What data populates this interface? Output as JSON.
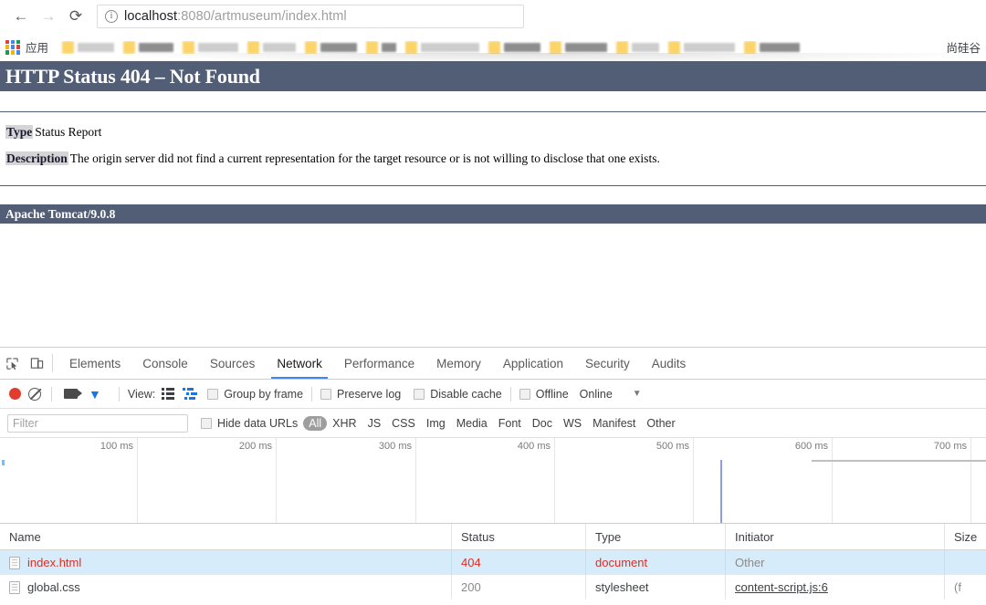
{
  "browser": {
    "back_icon": "←",
    "forward_icon": "→",
    "reload_icon": "⟳",
    "info_icon": "i",
    "url_host": "localhost",
    "url_rest": ":8080/artmuseum/index.html",
    "apps_label": "应用",
    "bookmark_last": "尚硅谷"
  },
  "page": {
    "title": "HTTP Status 404 – Not Found",
    "type_label": "Type",
    "type_value": "Status Report",
    "description_label": "Description",
    "description_value": "The origin server did not find a current representation for the target resource or is not willing to disclose that one exists.",
    "footer": "Apache Tomcat/9.0.8",
    "accent_color": "#525D76"
  },
  "devtools": {
    "tabs": [
      {
        "label": "Elements",
        "active": false
      },
      {
        "label": "Console",
        "active": false
      },
      {
        "label": "Sources",
        "active": false
      },
      {
        "label": "Network",
        "active": true
      },
      {
        "label": "Performance",
        "active": false
      },
      {
        "label": "Memory",
        "active": false
      },
      {
        "label": "Application",
        "active": false
      },
      {
        "label": "Security",
        "active": false
      },
      {
        "label": "Audits",
        "active": false
      }
    ],
    "toolbar": {
      "view_label": "View:",
      "group_by_frame": "Group by frame",
      "preserve_log": "Preserve log",
      "disable_cache": "Disable cache",
      "offline": "Offline",
      "online": "Online",
      "caret": "▼"
    },
    "filterbar": {
      "filter_placeholder": "Filter",
      "filter_value": "",
      "hide_data_urls": "Hide data URLs",
      "types": [
        "All",
        "XHR",
        "JS",
        "CSS",
        "Img",
        "Media",
        "Font",
        "Doc",
        "WS",
        "Manifest",
        "Other"
      ],
      "selected_type": "All"
    },
    "timeline": {
      "ticks": [
        "100 ms",
        "200 ms",
        "300 ms",
        "400 ms",
        "500 ms",
        "600 ms",
        "700 ms"
      ]
    },
    "table": {
      "columns": [
        "Name",
        "Status",
        "Type",
        "Initiator",
        "Size"
      ],
      "rows": [
        {
          "name": "index.html",
          "status": "404",
          "type": "document",
          "initiator": "Other",
          "size": "",
          "selected": true,
          "error": true
        },
        {
          "name": "global.css",
          "status": "200",
          "type": "stylesheet",
          "initiator": "content-script.js:6",
          "size": "(f",
          "selected": false,
          "error": false
        }
      ]
    }
  }
}
